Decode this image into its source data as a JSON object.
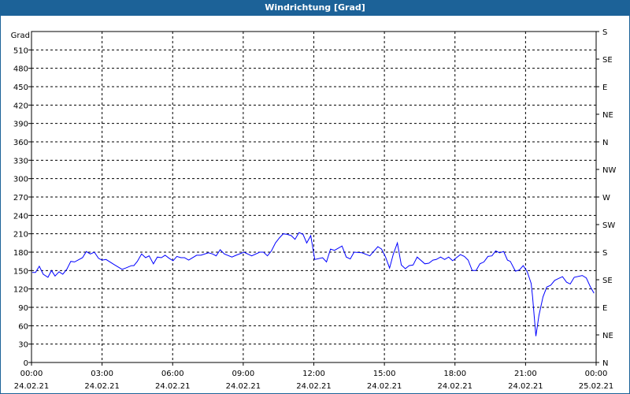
{
  "window": {
    "title": "Windrichtung [Grad]"
  },
  "chart_data": {
    "type": "line",
    "title": "Windrichtung [Grad]",
    "ylabel": "Grad",
    "ylim": [
      0,
      540
    ],
    "yticks": [
      0,
      30,
      60,
      90,
      120,
      150,
      180,
      210,
      240,
      270,
      300,
      330,
      360,
      390,
      420,
      450,
      480,
      510
    ],
    "right_axis": {
      "ticks": [
        0,
        45,
        90,
        135,
        180,
        225,
        270,
        315,
        360,
        405,
        450,
        495,
        540
      ],
      "labels": [
        "N",
        "NE",
        "E",
        "SE",
        "S",
        "SW",
        "W",
        "NW",
        "N",
        "NE",
        "E",
        "SE",
        "S"
      ]
    },
    "xlim_hours": [
      0,
      24
    ],
    "xticks": [
      {
        "h": 0,
        "time": "00:00",
        "date": "24.02.21"
      },
      {
        "h": 3,
        "time": "03:00",
        "date": "24.02.21"
      },
      {
        "h": 6,
        "time": "06:00",
        "date": "24.02.21"
      },
      {
        "h": 9,
        "time": "09:00",
        "date": "24.02.21"
      },
      {
        "h": 12,
        "time": "12:00",
        "date": "24.02.21"
      },
      {
        "h": 15,
        "time": "15:00",
        "date": "24.02.21"
      },
      {
        "h": 18,
        "time": "18:00",
        "date": "24.02.21"
      },
      {
        "h": 21,
        "time": "21:00",
        "date": "24.02.21"
      },
      {
        "h": 24,
        "time": "00:00",
        "date": "25.02.21"
      }
    ],
    "grid": true,
    "line_color": "#0000ff",
    "series": [
      {
        "name": "Windrichtung",
        "points": [
          [
            0.03,
            147
          ],
          [
            0.17,
            147
          ],
          [
            0.33,
            157
          ],
          [
            0.5,
            144
          ],
          [
            0.7,
            139
          ],
          [
            0.85,
            150
          ],
          [
            1.0,
            141
          ],
          [
            1.17,
            148
          ],
          [
            1.33,
            144
          ],
          [
            1.5,
            152
          ],
          [
            1.67,
            165
          ],
          [
            1.83,
            164
          ],
          [
            2.17,
            171
          ],
          [
            2.33,
            181
          ],
          [
            2.5,
            177
          ],
          [
            2.67,
            180
          ],
          [
            2.85,
            170
          ],
          [
            3.0,
            167
          ],
          [
            3.17,
            168
          ],
          [
            3.5,
            160
          ],
          [
            3.85,
            152
          ],
          [
            4.0,
            154
          ],
          [
            4.25,
            158
          ],
          [
            4.35,
            158
          ],
          [
            4.5,
            165
          ],
          [
            4.68,
            177
          ],
          [
            4.85,
            171
          ],
          [
            5.0,
            174
          ],
          [
            5.18,
            161
          ],
          [
            5.35,
            172
          ],
          [
            5.52,
            171
          ],
          [
            5.68,
            175
          ],
          [
            5.85,
            170
          ],
          [
            6.02,
            166
          ],
          [
            6.18,
            173
          ],
          [
            6.35,
            171
          ],
          [
            6.5,
            171
          ],
          [
            6.68,
            167
          ],
          [
            7.02,
            175
          ],
          [
            7.2,
            175
          ],
          [
            7.52,
            179
          ],
          [
            7.7,
            177
          ],
          [
            7.85,
            174
          ],
          [
            8.02,
            184
          ],
          [
            8.2,
            177
          ],
          [
            8.52,
            172
          ],
          [
            8.7,
            175
          ],
          [
            9.03,
            180
          ],
          [
            9.36,
            174
          ],
          [
            9.7,
            180
          ],
          [
            9.86,
            180
          ],
          [
            10.03,
            174
          ],
          [
            10.2,
            182
          ],
          [
            10.37,
            195
          ],
          [
            10.53,
            203
          ],
          [
            10.7,
            210
          ],
          [
            10.87,
            209
          ],
          [
            11.04,
            207
          ],
          [
            11.2,
            201
          ],
          [
            11.37,
            212
          ],
          [
            11.54,
            209
          ],
          [
            11.7,
            195
          ],
          [
            11.87,
            207
          ],
          [
            12.04,
            168
          ],
          [
            12.37,
            171
          ],
          [
            12.54,
            164
          ],
          [
            12.71,
            185
          ],
          [
            12.88,
            183
          ],
          [
            13.2,
            190
          ],
          [
            13.38,
            172
          ],
          [
            13.55,
            169
          ],
          [
            13.71,
            180
          ],
          [
            14.05,
            179
          ],
          [
            14.38,
            174
          ],
          [
            14.72,
            189
          ],
          [
            14.88,
            185
          ],
          [
            15.05,
            172
          ],
          [
            15.22,
            154
          ],
          [
            15.38,
            177
          ],
          [
            15.55,
            195
          ],
          [
            15.72,
            159
          ],
          [
            15.89,
            153
          ],
          [
            16.05,
            158
          ],
          [
            16.22,
            159
          ],
          [
            16.39,
            172
          ],
          [
            16.72,
            161
          ],
          [
            16.89,
            162
          ],
          [
            17.06,
            167
          ],
          [
            17.2,
            168
          ],
          [
            17.39,
            172
          ],
          [
            17.56,
            168
          ],
          [
            17.73,
            172
          ],
          [
            17.9,
            166
          ],
          [
            18.23,
            176
          ],
          [
            18.4,
            173
          ],
          [
            18.56,
            167
          ],
          [
            18.73,
            150
          ],
          [
            18.9,
            150
          ],
          [
            19.06,
            161
          ],
          [
            19.23,
            164
          ],
          [
            19.4,
            173
          ],
          [
            19.57,
            174
          ],
          [
            19.73,
            182
          ],
          [
            19.9,
            179
          ],
          [
            20.07,
            181
          ],
          [
            20.23,
            167
          ],
          [
            20.35,
            165
          ],
          [
            20.57,
            149
          ],
          [
            20.74,
            151
          ],
          [
            20.9,
            158
          ],
          [
            21.07,
            148
          ],
          [
            21.24,
            129
          ],
          [
            21.3,
            107
          ],
          [
            21.44,
            43
          ],
          [
            21.57,
            77
          ],
          [
            21.74,
            107
          ],
          [
            21.9,
            123
          ],
          [
            22.07,
            126
          ],
          [
            22.24,
            134
          ],
          [
            22.4,
            137
          ],
          [
            22.57,
            140
          ],
          [
            22.74,
            131
          ],
          [
            22.9,
            128
          ],
          [
            23.07,
            139
          ],
          [
            23.41,
            142
          ],
          [
            23.58,
            138
          ],
          [
            23.75,
            124
          ],
          [
            23.91,
            113
          ]
        ]
      }
    ]
  }
}
